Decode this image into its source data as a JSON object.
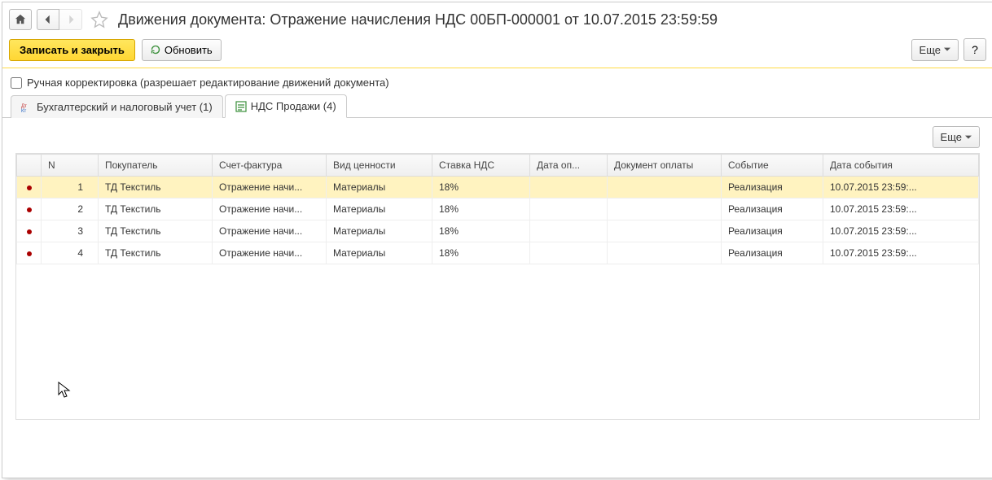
{
  "header": {
    "title": "Движения документа: Отражение начисления НДС 00БП-000001 от 10.07.2015 23:59:59"
  },
  "toolbar": {
    "save_close": "Записать и закрыть",
    "refresh": "Обновить",
    "more": "Еще",
    "help": "?"
  },
  "options": {
    "manual_edit": "Ручная корректировка (разрешает редактирование движений документа)"
  },
  "tabs": {
    "accounting": "Бухгалтерский и налоговый учет (1)",
    "vat_sales": "НДС Продажи (4)"
  },
  "table": {
    "headers": {
      "n": "N",
      "buyer": "Покупатель",
      "invoice": "Счет-фактура",
      "value_type": "Вид ценности",
      "vat_rate": "Ставка НДС",
      "pay_date": "Дата оп...",
      "pay_doc": "Документ оплаты",
      "event": "Событие",
      "event_date": "Дата события"
    },
    "rows": [
      {
        "n": "1",
        "buyer": "ТД Текстиль",
        "invoice": "Отражение начи...",
        "value_type": "Материалы",
        "vat_rate": "18%",
        "pay_date": "",
        "pay_doc": "",
        "event": "Реализация",
        "event_date": "10.07.2015 23:59:..."
      },
      {
        "n": "2",
        "buyer": "ТД Текстиль",
        "invoice": "Отражение начи...",
        "value_type": "Материалы",
        "vat_rate": "18%",
        "pay_date": "",
        "pay_doc": "",
        "event": "Реализация",
        "event_date": "10.07.2015 23:59:..."
      },
      {
        "n": "3",
        "buyer": "ТД Текстиль",
        "invoice": "Отражение начи...",
        "value_type": "Материалы",
        "vat_rate": "18%",
        "pay_date": "",
        "pay_doc": "",
        "event": "Реализация",
        "event_date": "10.07.2015 23:59:..."
      },
      {
        "n": "4",
        "buyer": "ТД Текстиль",
        "invoice": "Отражение начи...",
        "value_type": "Материалы",
        "vat_rate": "18%",
        "pay_date": "",
        "pay_doc": "",
        "event": "Реализация",
        "event_date": "10.07.2015 23:59:..."
      }
    ]
  }
}
